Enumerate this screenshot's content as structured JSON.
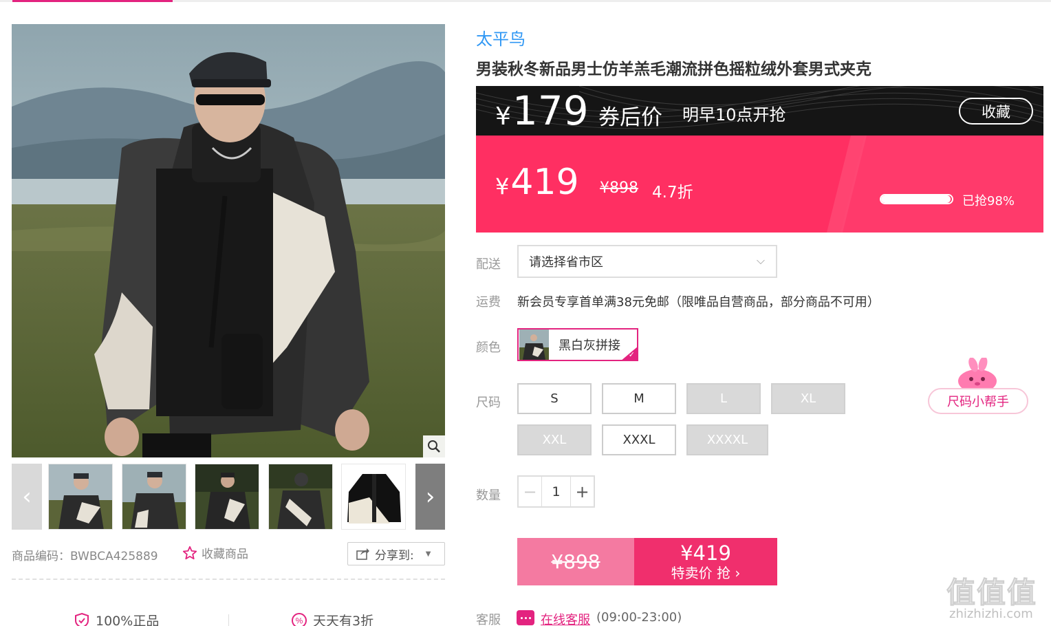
{
  "gallery": {
    "product_code_label": "商品编码：",
    "product_code": "BWBCA425889",
    "favorite_label": "收藏商品",
    "share_label": "分享到:",
    "thumb_count": 5
  },
  "assurances": [
    {
      "icon": "shield-check-icon",
      "text": "100%正品"
    },
    {
      "icon": "discount-badge-icon",
      "text": "天天有3折"
    }
  ],
  "product": {
    "brand": "太平鸟",
    "title": "男装秋冬新品男士仿羊羔毛潮流拼色摇粒绒外套男式夹克"
  },
  "promo": {
    "currency": "¥",
    "coupon_price": "179",
    "coupon_label": "券后价",
    "start_time": "明早10点开抢",
    "collect_label": "收藏",
    "sale_price": "419",
    "original_price": "¥898",
    "discount": "4.7折",
    "sold_percent": 98,
    "sold_text": "已抢98%",
    "colors": {
      "dark": "#151515",
      "sale": "#ff2f62",
      "accent": "#e3237f"
    }
  },
  "delivery": {
    "label": "配送",
    "placeholder": "请选择省市区"
  },
  "shipping": {
    "label": "运费",
    "text": "新会员专享首单满38元免邮（限唯品自营商品，部分商品不可用）"
  },
  "color": {
    "label": "颜色",
    "selected": "黑白灰拼接"
  },
  "size": {
    "label": "尺码",
    "options": [
      {
        "label": "S",
        "available": true
      },
      {
        "label": "M",
        "available": true
      },
      {
        "label": "L",
        "available": false
      },
      {
        "label": "XL",
        "available": false
      },
      {
        "label": "XXL",
        "available": false
      },
      {
        "label": "XXXL",
        "available": true
      },
      {
        "label": "XXXXL",
        "available": false
      }
    ],
    "helper_label": "尺码小帮手"
  },
  "quantity": {
    "label": "数量",
    "value": "1",
    "minus": "−",
    "plus": "+"
  },
  "buy": {
    "original_price": "¥898",
    "price": "¥419",
    "action": "特卖价 抢 ›"
  },
  "service": {
    "label": "客服",
    "link": "在线客服",
    "hours": "(09:00-23:00)"
  },
  "watermark": {
    "text": "值值值",
    "domain": "zhizhizhi.com"
  }
}
